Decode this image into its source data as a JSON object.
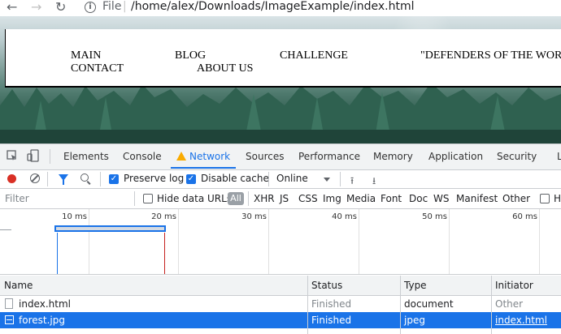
{
  "address_bar": {
    "scheme_label": "File",
    "separator": "|",
    "url": "/home/alex/Downloads/ImageExample/index.html"
  },
  "page": {
    "nav_links": {
      "main": "MAIN",
      "blog": "BLOG",
      "challenge": "CHALLENGE",
      "defenders": "\"DEFENDERS OF THE WORL",
      "contact": "CONTACT",
      "about": "ABOUT US"
    }
  },
  "devtools": {
    "tabs": {
      "elements": "Elements",
      "console": "Console",
      "network": "Network",
      "sources": "Sources",
      "performance": "Performance",
      "memory": "Memory",
      "application": "Application",
      "security": "Security",
      "overflow": "L"
    },
    "toolbar": {
      "preserve_log": "Preserve log",
      "disable_cache": "Disable cache",
      "throttling": "Online"
    },
    "filter": {
      "placeholder": "Filter",
      "hide_data_urls": "Hide data URLs",
      "all": "All",
      "types": {
        "xhr": "XHR",
        "js": "JS",
        "css": "CSS",
        "img": "Img",
        "media": "Media",
        "font": "Font",
        "doc": "Doc",
        "ws": "WS",
        "manifest": "Manifest",
        "other": "Other",
        "overflow": "H"
      }
    },
    "timeline": {
      "ticks": [
        "10 ms",
        "20 ms",
        "30 ms",
        "40 ms",
        "50 ms",
        "60 ms"
      ]
    },
    "table": {
      "columns": {
        "name": "Name",
        "status": "Status",
        "type": "Type",
        "initiator": "Initiator"
      },
      "rows": [
        {
          "name": "index.html",
          "status": "Finished",
          "type": "document",
          "initiator": "Other"
        },
        {
          "name": "forest.jpg",
          "status": "Finished",
          "type": "jpeg",
          "initiator": "index.html"
        }
      ]
    },
    "colors": {
      "accent": "#1a73e8",
      "record": "#d93025",
      "warning": "#f9ab00"
    }
  }
}
